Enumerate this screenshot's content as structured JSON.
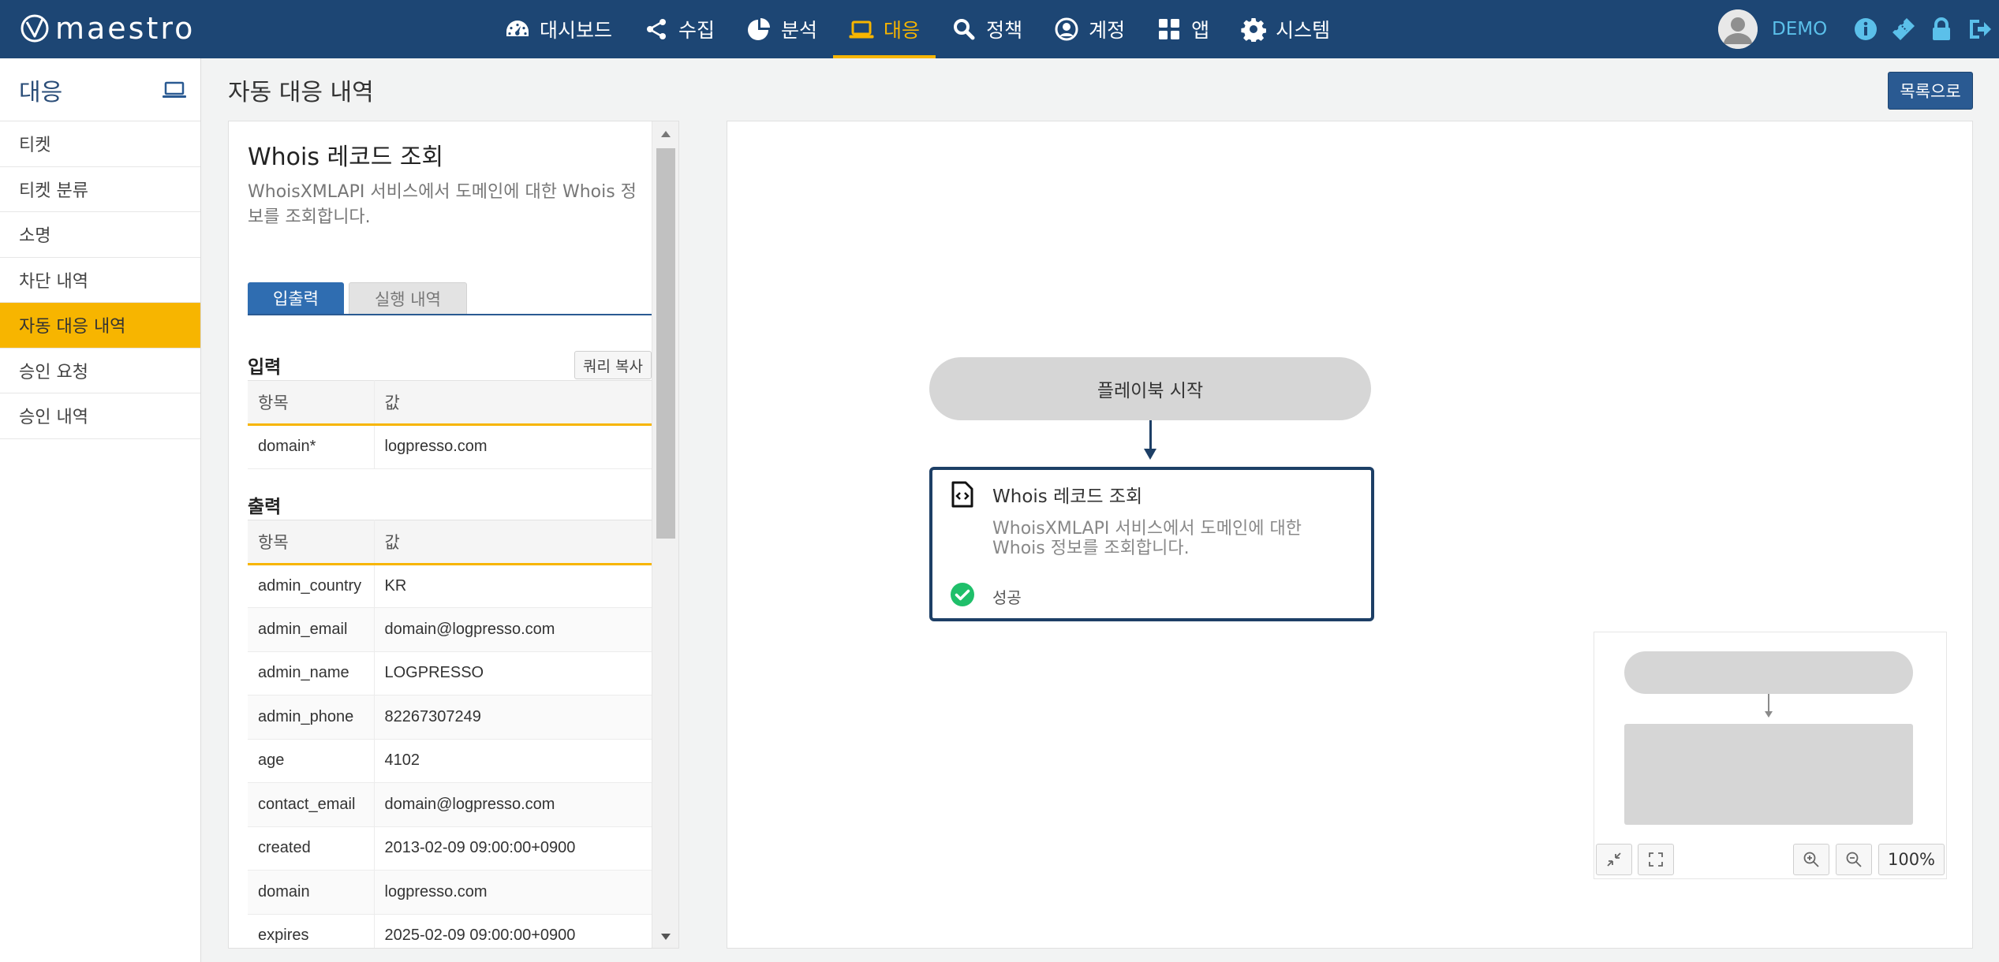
{
  "app": {
    "logo_text": "maestro",
    "user_name": "DEMO"
  },
  "nav": [
    {
      "label": "대시보드",
      "icon": "dashboard-icon"
    },
    {
      "label": "수집",
      "icon": "share-icon"
    },
    {
      "label": "분석",
      "icon": "pie-chart-icon"
    },
    {
      "label": "대응",
      "icon": "laptop-icon",
      "active": true
    },
    {
      "label": "정책",
      "icon": "search-icon"
    },
    {
      "label": "계정",
      "icon": "user-circle-icon"
    },
    {
      "label": "앱",
      "icon": "apps-grid-icon"
    },
    {
      "label": "시스템",
      "icon": "gear-icon"
    }
  ],
  "sidebar": {
    "title": "대응",
    "items": [
      {
        "label": "티켓"
      },
      {
        "label": "티켓 분류"
      },
      {
        "label": "소명"
      },
      {
        "label": "차단 내역"
      },
      {
        "label": "자동 대응 내역",
        "active": true
      },
      {
        "label": "승인 요청"
      },
      {
        "label": "승인 내역"
      }
    ]
  },
  "main": {
    "title": "자동 대응 내역",
    "list_button": "목록으로"
  },
  "detail": {
    "title": "Whois 레코드 조회",
    "description": "WhoisXMLAPI 서비스에서 도메인에 대한 Whois 정보를 조회합니다.",
    "tabs": [
      {
        "label": "입출력",
        "active": true
      },
      {
        "label": "실행 내역"
      }
    ],
    "input_section": "입력",
    "copy_query_button": "쿼리 복사",
    "col_item": "항목",
    "col_value": "값",
    "inputs": [
      {
        "key": "domain*",
        "value": "logpresso.com"
      }
    ],
    "output_section": "출력",
    "outputs": [
      {
        "key": "admin_country",
        "value": "KR"
      },
      {
        "key": "admin_email",
        "value": "domain@logpresso.com"
      },
      {
        "key": "admin_name",
        "value": "LOGPRESSO"
      },
      {
        "key": "admin_phone",
        "value": "82267307249"
      },
      {
        "key": "age",
        "value": "4102"
      },
      {
        "key": "contact_email",
        "value": "domain@logpresso.com"
      },
      {
        "key": "created",
        "value": "2013-02-09 09:00:00+0900"
      },
      {
        "key": "domain",
        "value": "logpresso.com"
      },
      {
        "key": "expires",
        "value": "2025-02-09 09:00:00+0900"
      }
    ]
  },
  "flow": {
    "start_label": "플레이북 시작",
    "task_title": "Whois 레코드 조회",
    "task_description": "WhoisXMLAPI 서비스에서 도메인에 대한 Whois 정보를 조회합니다.",
    "task_status": "성공",
    "zoom": "100%"
  },
  "colors": {
    "navbar": "#1d4674",
    "accent": "#f7b500",
    "user": "#5bc0ea",
    "success": "#1fbf6a"
  }
}
